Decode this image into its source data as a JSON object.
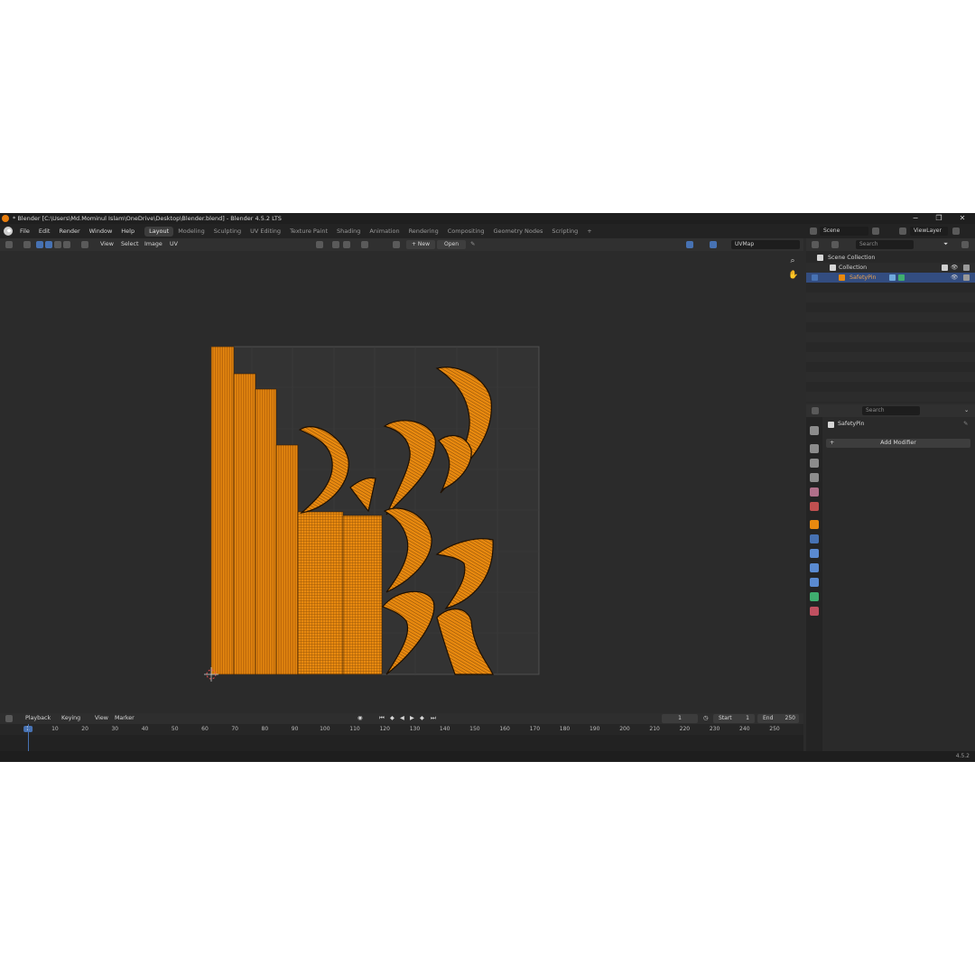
{
  "window": {
    "title": "* Blender [C:\\Users\\Md.Mominul Islam\\OneDrive\\Desktop\\Blender.blend] - Blender 4.5.2 LTS",
    "minimize": "−",
    "maximize": "❐",
    "close": "✕"
  },
  "menu": [
    "File",
    "Edit",
    "Render",
    "Window",
    "Help"
  ],
  "workspaces": [
    "Layout",
    "Modeling",
    "Sculpting",
    "UV Editing",
    "Texture Paint",
    "Shading",
    "Animation",
    "Rendering",
    "Compositing",
    "Geometry Nodes",
    "Scripting"
  ],
  "workspace_add": "+",
  "scene": {
    "name": "Scene",
    "view_layer": "ViewLayer"
  },
  "uv_header": {
    "menus": [
      "View",
      "Select",
      "Image",
      "UV"
    ],
    "new_label": "+ New",
    "open_label": "Open",
    "uvmap": "UVMap"
  },
  "timeline": {
    "menus": [
      "Playback",
      "Keying",
      "View",
      "Marker"
    ],
    "current_frame": "1",
    "start_label": "Start",
    "start": "1",
    "end_label": "End",
    "end": "250",
    "ticks": [
      "1",
      "10",
      "20",
      "30",
      "40",
      "50",
      "60",
      "70",
      "80",
      "90",
      "100",
      "110",
      "120",
      "130",
      "140",
      "150",
      "160",
      "170",
      "180",
      "190",
      "200",
      "210",
      "220",
      "230",
      "240",
      "250"
    ]
  },
  "outliner": {
    "search_placeholder": "Search",
    "rows": [
      "Scene Collection",
      "Collection",
      "SafetyPin"
    ]
  },
  "properties": {
    "search_placeholder": "Search",
    "object_name": "SafetyPin",
    "add_modifier": "Add Modifier"
  },
  "status": {
    "version": "4.5.2"
  },
  "colors": {
    "uv_orange": "#e8890f",
    "selection_blue": "#334d80",
    "accent_blue": "#4772b3"
  }
}
